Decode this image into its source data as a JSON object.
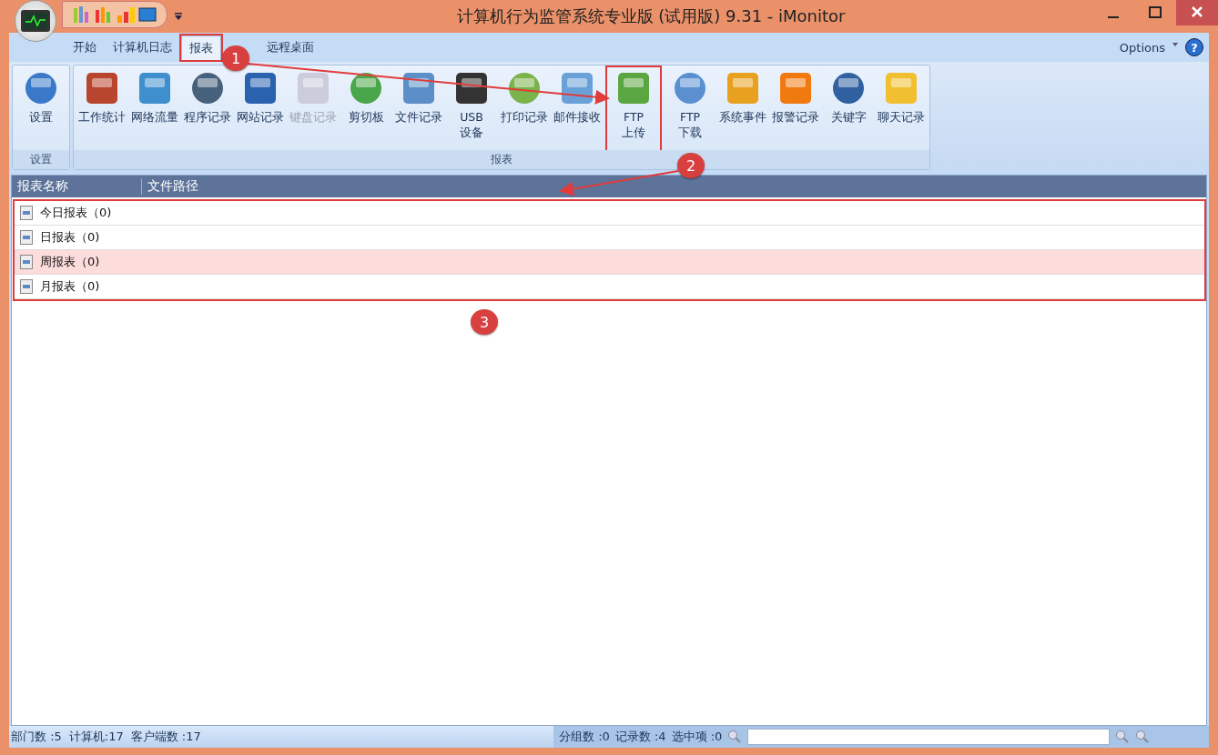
{
  "window": {
    "title": "计算机行为监管系统专业版 (试用版) 9.31 - iMonitor"
  },
  "tabs": [
    {
      "label": "开始",
      "selected": false
    },
    {
      "label": "计算机日志",
      "selected": false
    },
    {
      "label": "报表",
      "selected": true,
      "highlighted": true
    },
    {
      "label": "远程桌面",
      "selected": false
    }
  ],
  "options": "Options",
  "help": "?",
  "ribbon_groups": [
    {
      "label": "设置",
      "buttons": [
        {
          "label": "设置",
          "disabled": false
        }
      ]
    },
    {
      "label": "报表",
      "buttons": [
        {
          "label": "工作统计",
          "disabled": false
        },
        {
          "label": "网络流量",
          "disabled": false
        },
        {
          "label": "程序记录",
          "disabled": false
        },
        {
          "label": "网站记录",
          "disabled": false
        },
        {
          "label": "键盘记录",
          "disabled": true
        },
        {
          "label": "剪切板",
          "disabled": false
        },
        {
          "label": "文件记录",
          "disabled": false
        },
        {
          "label": "USB\n设备",
          "disabled": false
        },
        {
          "label": "打印记录",
          "disabled": false
        },
        {
          "label": "邮件接收",
          "disabled": false
        },
        {
          "label": "FTP\n上传",
          "disabled": false,
          "highlighted": true
        },
        {
          "label": "FTP\n下载",
          "disabled": false
        },
        {
          "label": "系统事件",
          "disabled": false
        },
        {
          "label": "报警记录",
          "disabled": false
        },
        {
          "label": "关键字",
          "disabled": false
        },
        {
          "label": "聊天记录",
          "disabled": false
        }
      ]
    }
  ],
  "table": {
    "highlighted": true,
    "columns": [
      "报表名称",
      "文件路径"
    ],
    "rows": [
      {
        "name": "今日报表（0)",
        "selected": false
      },
      {
        "name": "日报表（0)",
        "selected": false
      },
      {
        "name": "周报表（0)",
        "selected": true
      },
      {
        "name": "月报表（0)",
        "selected": false
      }
    ]
  },
  "status_bar": {
    "left": [
      "部门数 :5",
      "计算机:17",
      "客户端数 :17"
    ],
    "right": [
      "分组数 :0",
      "记录数 :4",
      "选中项 :0"
    ]
  },
  "annotations": [
    "1",
    "2",
    "3"
  ]
}
